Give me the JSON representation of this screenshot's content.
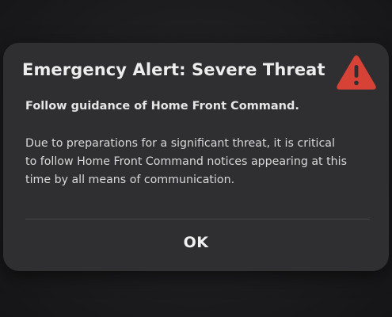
{
  "alert": {
    "title": "Emergency Alert: Severe Threat",
    "icon": "warning-triangle-icon",
    "accent_color": "#d64236",
    "subtitle": "Follow guidance of Home Front Command.",
    "body_lines": [
      "Due to preparations for a significant threat, it is critical",
      "to follow Home Front Command notices appearing at this",
      "time by all means of communication."
    ],
    "ok_label": "OK"
  }
}
